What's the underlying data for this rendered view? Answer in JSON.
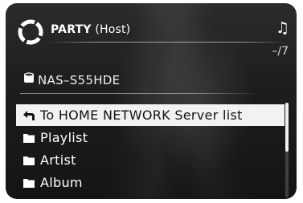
{
  "header": {
    "party_name": "PARTY",
    "party_role": "(Host)",
    "track_counter": "–/7",
    "party_icon": "party-ring-icon",
    "music_icon": "music-note-icon"
  },
  "server": {
    "name": "NAS–S55HDE",
    "icon": "server-disk-icon"
  },
  "list": {
    "items": [
      {
        "label": "To HOME NETWORK Server list",
        "icon": "back-arrow-icon",
        "selected": true
      },
      {
        "label": "Playlist",
        "icon": "folder-icon",
        "selected": false
      },
      {
        "label": "Artist",
        "icon": "folder-icon",
        "selected": false
      },
      {
        "label": "Album",
        "icon": "folder-icon",
        "selected": false
      }
    ]
  },
  "scroll": {
    "position_fraction": 0.0,
    "visible_fraction": 0.52
  },
  "colors": {
    "selection_bg": "#f2f2f2",
    "screen_bg": "#1e1e1e",
    "text": "#ffffff"
  }
}
